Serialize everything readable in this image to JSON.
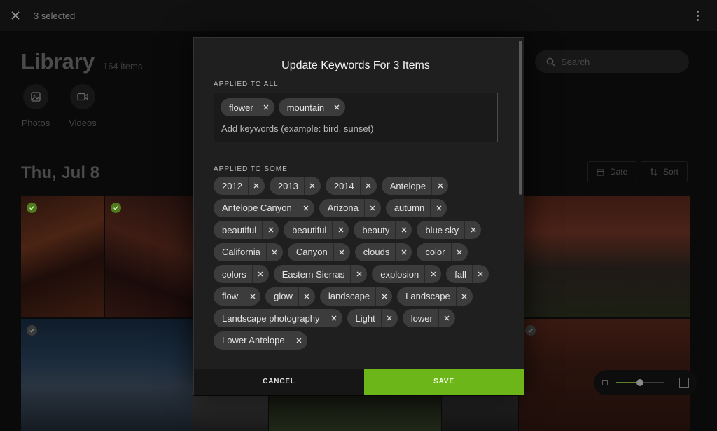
{
  "topbar": {
    "selected_text": "3 selected",
    "close_icon": "close-icon",
    "menu_icon": "more-vertical-icon"
  },
  "library": {
    "title": "Library",
    "count": "164 items",
    "tabs": [
      {
        "label": "Photos",
        "icon": "image-icon"
      },
      {
        "label": "Videos",
        "icon": "video-icon"
      }
    ],
    "search_placeholder": "Search",
    "date_heading": "Thu, Jul 8",
    "date_button": "Date",
    "sort_button": "Sort"
  },
  "modal": {
    "title": "Update Keywords For 3 Items",
    "applied_all_label": "APPLIED TO ALL",
    "applied_all": [
      "flower",
      "mountain"
    ],
    "input_placeholder": "Add keywords (example: bird, sunset)",
    "applied_some_label": "APPLIED TO SOME",
    "applied_some": [
      "2012",
      "2013",
      "2014",
      "Antelope",
      "Antelope Canyon",
      "Arizona",
      "autumn",
      "beautiful",
      "beautiful",
      "beauty",
      "blue sky",
      "California",
      "Canyon",
      "clouds",
      "color",
      "colors",
      "Eastern Sierras",
      "explosion",
      "fall",
      "flow",
      "glow",
      "landscape",
      "Landscape",
      "Landscape photography",
      "Light",
      "lower",
      "Lower Antelope"
    ],
    "cancel_label": "CANCEL",
    "save_label": "SAVE"
  },
  "colors": {
    "accent": "#6cb619",
    "modal_bg": "#1f1f1f",
    "chip_bg": "#3c3c3c"
  }
}
